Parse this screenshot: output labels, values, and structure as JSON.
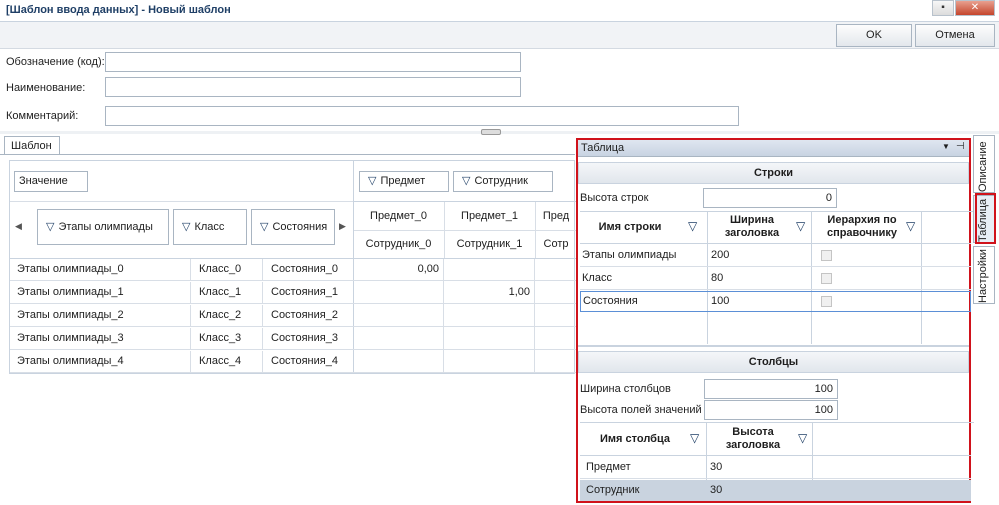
{
  "window": {
    "title": "[Шаблон ввода данных] - Новый шаблон",
    "ok": "OK",
    "cancel": "Отмена"
  },
  "form": {
    "code_label": "Обозначение (код):",
    "name_label": "Наименование:",
    "comment_label": "Комментарий:"
  },
  "tabs": {
    "template": "Шаблон"
  },
  "grid": {
    "value_label": "Значение",
    "col_filters": [
      "Предмет",
      "Сотрудник"
    ],
    "row_filters": [
      "Этапы олимпиады",
      "Класс",
      "Состояния"
    ],
    "col_headers_top": [
      "Предмет_0",
      "Предмет_1",
      "Пред"
    ],
    "col_headers_bottom": [
      "Сотрудник_0",
      "Сотрудник_1",
      "Сотр"
    ],
    "rows": [
      {
        "a": "Этапы олимпиады_0",
        "b": "Класс_0",
        "c": "Состояния_0",
        "v0": "0,00",
        "v1": ""
      },
      {
        "a": "Этапы олимпиады_1",
        "b": "Класс_1",
        "c": "Состояния_1",
        "v0": "",
        "v1": "1,00"
      },
      {
        "a": "Этапы олимпиады_2",
        "b": "Класс_2",
        "c": "Состояния_2",
        "v0": "",
        "v1": ""
      },
      {
        "a": "Этапы олимпиады_3",
        "b": "Класс_3",
        "c": "Состояния_3",
        "v0": "",
        "v1": ""
      },
      {
        "a": "Этапы олимпиады_4",
        "b": "Класс_4",
        "c": "Состояния_4",
        "v0": "",
        "v1": ""
      }
    ]
  },
  "panel": {
    "title": "Таблица",
    "rows_section": "Строки",
    "row_height_label": "Высота строк",
    "row_height_value": "0",
    "rows_table": {
      "headers": [
        "Имя строки",
        "Ширина заголовка",
        "Иерархия по справочнику"
      ],
      "rows": [
        {
          "name": "Этапы олимпиады",
          "width": "200"
        },
        {
          "name": "Класс",
          "width": "80"
        },
        {
          "name": "Состояния",
          "width": "100"
        }
      ]
    },
    "cols_section": "Столбцы",
    "col_width_label": "Ширина столбцов",
    "col_width_value": "100",
    "value_height_label": "Высота полей значений",
    "value_height_value": "100",
    "cols_table": {
      "headers": [
        "Имя столбца",
        "Высота заголовка"
      ],
      "rows": [
        {
          "name": "Предмет",
          "height": "30"
        },
        {
          "name": "Сотрудник",
          "height": "30"
        }
      ]
    }
  },
  "side_tabs": [
    "Описание",
    "Таблица",
    "Настройки"
  ]
}
